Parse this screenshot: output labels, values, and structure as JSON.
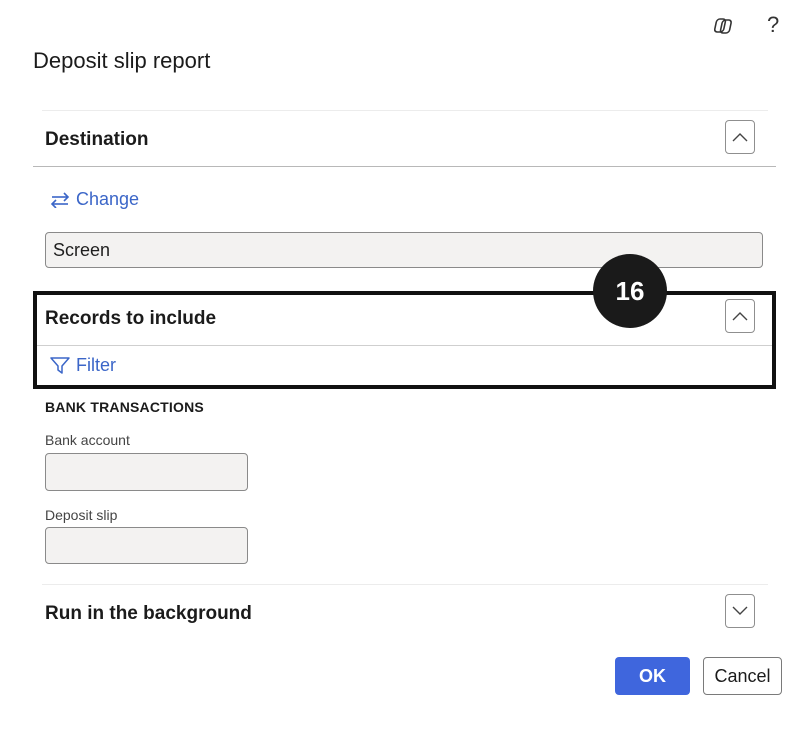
{
  "header": {
    "copilot_icon": "copilot-icon",
    "help_icon": "help-icon",
    "help_glyph": "?",
    "title": "Deposit slip report"
  },
  "destination": {
    "title": "Destination",
    "toggle_icon": "chevron-up-icon",
    "change_label": "Change",
    "value": "Screen"
  },
  "annotation": {
    "number": "16"
  },
  "records": {
    "title": "Records to include",
    "toggle_icon": "chevron-up-icon",
    "filter_label": "Filter",
    "group_title": "BANK TRANSACTIONS",
    "bank_account_label": "Bank account",
    "bank_account_value": "",
    "deposit_slip_label": "Deposit slip",
    "deposit_slip_value": ""
  },
  "background": {
    "title": "Run in the background",
    "toggle_icon": "chevron-down-icon"
  },
  "footer": {
    "ok_label": "OK",
    "cancel_label": "Cancel"
  },
  "colors": {
    "accent": "#3f66dd",
    "link": "#3b66c8",
    "field_fill": "#f3f2f1",
    "annotation": "#1a1a1a"
  }
}
